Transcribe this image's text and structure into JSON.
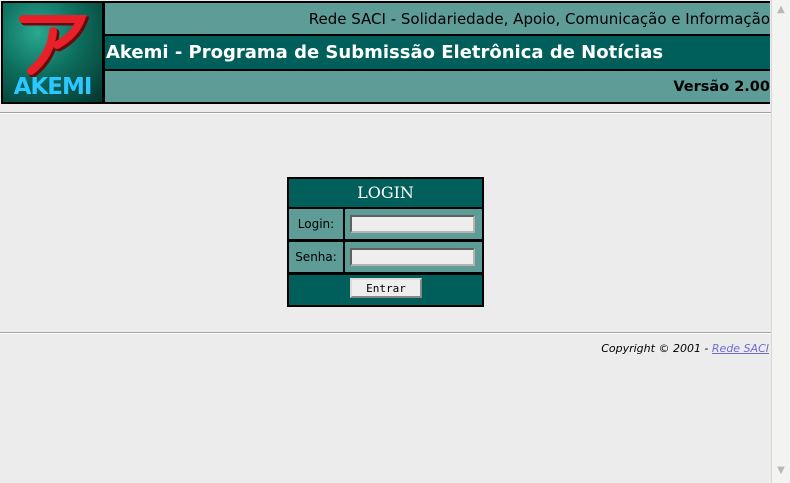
{
  "header": {
    "logo_text": "AKEMI",
    "organization": "Rede SACI - Solidariedade, Apoio, Comunicação e Informação",
    "title": "Akemi - Programa de Submissão Eletrônica de Notícias",
    "version": "Versão 2.00"
  },
  "login": {
    "title": "LOGIN",
    "login_label": "Login:",
    "login_value": "",
    "password_label": "Senha:",
    "password_value": "",
    "submit_label": "Entrar"
  },
  "footer": {
    "copyright": "Copyright © 2001 - ",
    "link_text": "Rede SACI"
  },
  "colors": {
    "dark_teal": "#005f5a",
    "light_teal": "#5e9c97",
    "logo_red": "#e8202a",
    "logo_text": "#29c9ff",
    "link": "#6d6dd0"
  },
  "icons": {
    "scroll_up": "scroll-up-arrow-icon",
    "scroll_down": "scroll-down-arrow-icon"
  }
}
